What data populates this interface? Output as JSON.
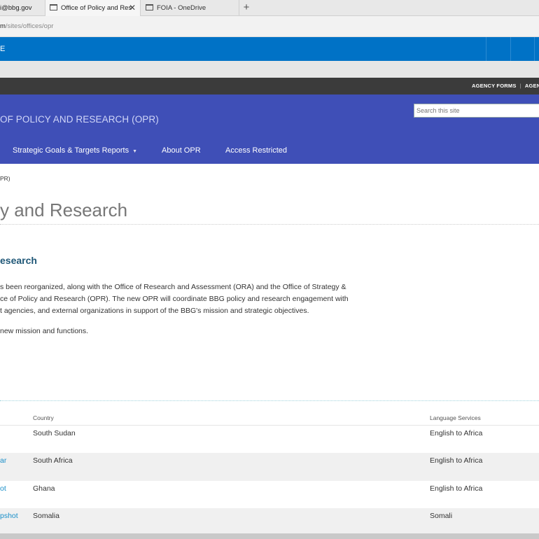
{
  "browser": {
    "tabs": [
      {
        "label": "i@bbg.gov"
      },
      {
        "label": "Office of Policy and Res"
      },
      {
        "label": "FOIA - OneDrive"
      }
    ],
    "close_glyph": "✕",
    "new_tab_glyph": "+",
    "url_bold": "m",
    "url_rest": "/sites/offices/opr"
  },
  "suitebar": {
    "text": "E"
  },
  "topbar": {
    "links": [
      "AGENCY FORMS",
      "AGENC"
    ],
    "separator": "|"
  },
  "header": {
    "site_title": "OF POLICY AND RESEARCH (OPR)",
    "search_placeholder": "Search this site",
    "nav": [
      {
        "label": "Strategic Goals & Targets Reports",
        "caret": "▼"
      },
      {
        "label": "About OPR"
      },
      {
        "label": "Access Restricted"
      }
    ]
  },
  "main": {
    "breadcrumb": "PR)",
    "page_title": "y and Research",
    "section_heading": "esearch",
    "paragraph_lines": [
      "s been reorganized, along with the Office of Research and Assessment (ORA) and the Office of Strategy &",
      "ce of Policy and Research (OPR).  The new OPR will coordinate BBG policy and research engagement with",
      "t agencies, and external organizations in support of the BBG's mission and strategic objectives."
    ],
    "paragraph2": " new mission and functions."
  },
  "table": {
    "headers": {
      "country": "Country",
      "language": "Language Services"
    },
    "rows": [
      {
        "link": "",
        "country": "South Sudan",
        "language": "English to Africa"
      },
      {
        "link": "ar",
        "country": "South Africa",
        "language": "English to Africa"
      },
      {
        "link": "ot",
        "country": "Ghana",
        "language": "English to Africa"
      },
      {
        "link": "pshot",
        "country": "Somalia",
        "language": "Somali"
      }
    ]
  },
  "colors": {
    "suitebar": "#0072c6",
    "topbar": "#3b3b3b",
    "header": "#3f4fb7",
    "link": "#1a8fc9",
    "heading": "#1f5777"
  }
}
